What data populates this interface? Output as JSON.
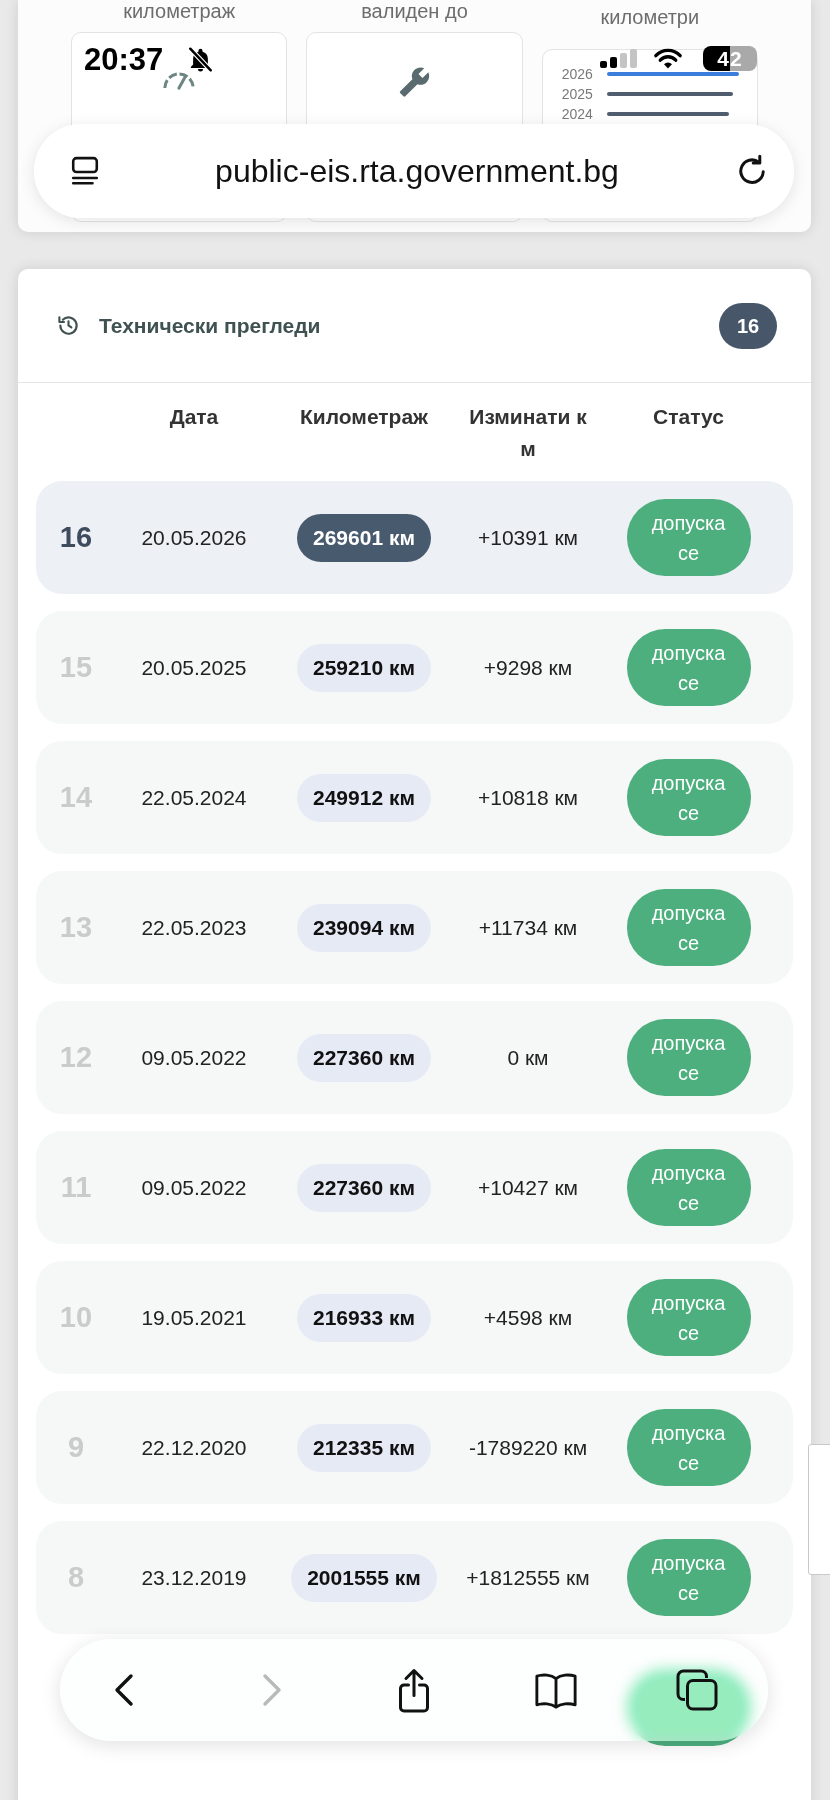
{
  "status_bar": {
    "time": "20:37",
    "battery": "42"
  },
  "summary": {
    "tiles": [
      {
        "kind": "gauge",
        "label": "километраж"
      },
      {
        "kind": "wrench",
        "label": "валиден до"
      },
      {
        "kind": "chart",
        "label": "километри",
        "bars": [
          {
            "year": "2026",
            "highlighted": true
          },
          {
            "year": "2025",
            "highlighted": false
          },
          {
            "year": "2024",
            "highlighted": false
          }
        ]
      }
    ]
  },
  "address_bar": {
    "url": "public-eis.rta.government.bg"
  },
  "inspections": {
    "title": "Технически прегледи",
    "count": "16",
    "columns": [
      "Дата",
      "Километраж",
      "Изминати км",
      "Статус"
    ],
    "rows": [
      {
        "kind": "entry",
        "selected": true,
        "number": "16",
        "date": "20.05.2026",
        "mileage": "269601 км",
        "distance": "+10391 км",
        "status": "допуска се"
      },
      {
        "kind": "entry",
        "selected": false,
        "number": "15",
        "date": "20.05.2025",
        "mileage": "259210 км",
        "distance": "+9298 км",
        "status": "допуска се"
      },
      {
        "kind": "entry",
        "selected": false,
        "number": "14",
        "date": "22.05.2024",
        "mileage": "249912 км",
        "distance": "+10818 км",
        "status": "допуска се"
      },
      {
        "kind": "entry",
        "selected": false,
        "number": "13",
        "date": "22.05.2023",
        "mileage": "239094 км",
        "distance": "+11734 км",
        "status": "допуска се"
      },
      {
        "kind": "entry",
        "selected": false,
        "number": "12",
        "date": "09.05.2022",
        "mileage": "227360 км",
        "distance": "0 км",
        "status": "допуска се"
      },
      {
        "kind": "entry",
        "selected": false,
        "number": "11",
        "date": "09.05.2022",
        "mileage": "227360 км",
        "distance": "+10427 км",
        "status": "допуска се"
      },
      {
        "kind": "entry",
        "selected": false,
        "number": "10",
        "date": "19.05.2021",
        "mileage": "216933 км",
        "distance": "+4598 км",
        "status": "допуска се"
      },
      {
        "kind": "entry",
        "selected": false,
        "number": "9",
        "date": "22.12.2020",
        "mileage": "212335 км",
        "distance": "-1789220 км",
        "status": "допуска се"
      },
      {
        "kind": "entry",
        "selected": false,
        "number": "8",
        "date": "23.12.2019",
        "mileage": "2001555 км",
        "distance": "+1812555 км",
        "status": "допуска се"
      },
      {
        "kind": "covered"
      }
    ]
  },
  "browser_toolbar": {
    "back_disabled": false,
    "forward_disabled": true
  }
}
